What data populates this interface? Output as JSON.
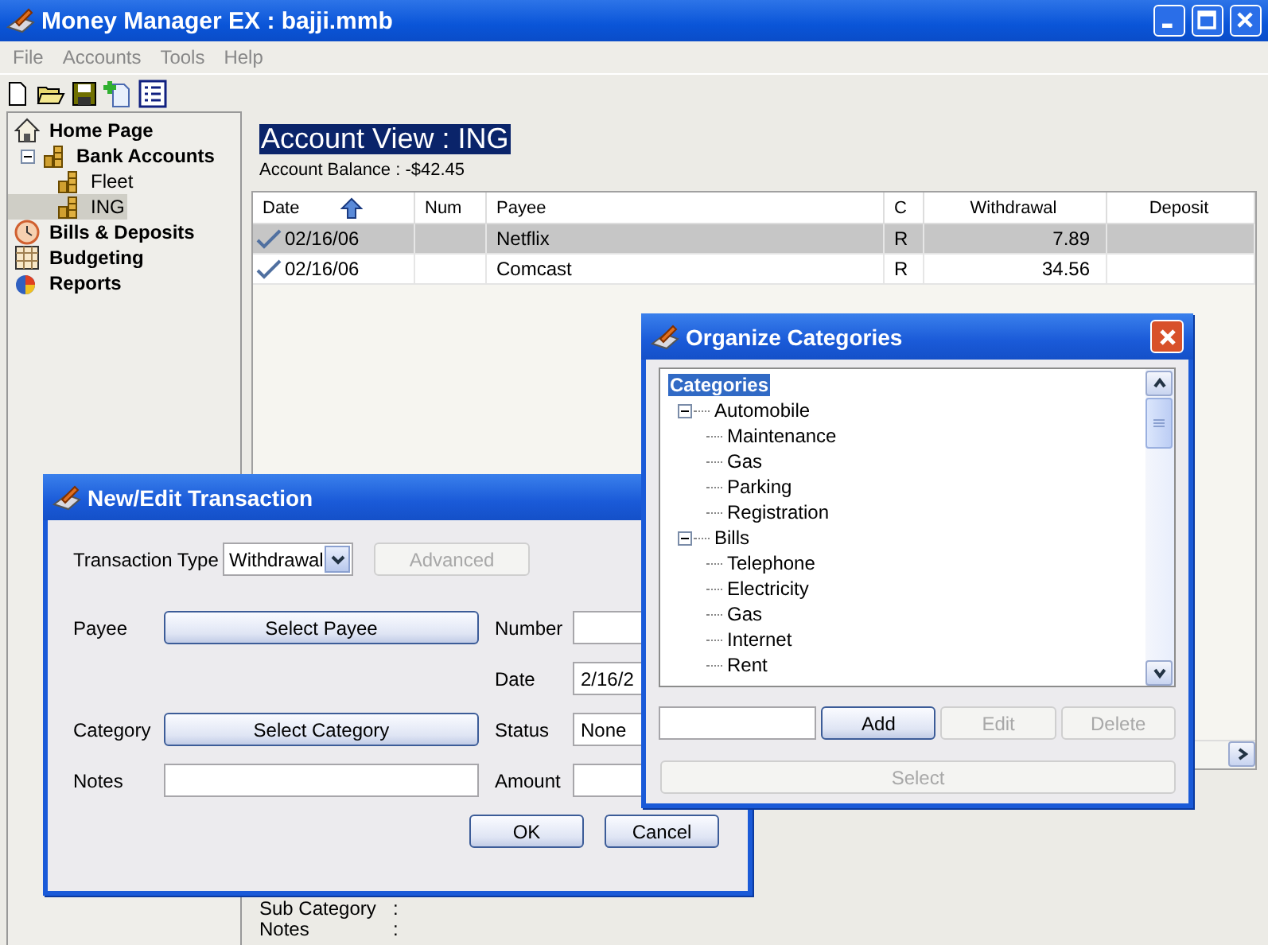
{
  "window": {
    "title": "Money Manager EX : bajji.mmb"
  },
  "menu": [
    "File",
    "Accounts",
    "Tools",
    "Help"
  ],
  "sidebar": {
    "items": [
      {
        "label": "Home Page",
        "kind": "home",
        "selected": false
      },
      {
        "label": "Bank Accounts",
        "kind": "accounts",
        "selected": false,
        "expanded": true,
        "children": [
          {
            "label": "Fleet",
            "kind": "account",
            "selected": false
          },
          {
            "label": "ING",
            "kind": "account",
            "selected": true
          }
        ]
      },
      {
        "label": "Bills & Deposits",
        "kind": "bills",
        "selected": false
      },
      {
        "label": "Budgeting",
        "kind": "budget",
        "selected": false
      },
      {
        "label": "Reports",
        "kind": "reports",
        "selected": false
      }
    ]
  },
  "account_view": {
    "title": "Account View : ING",
    "balance": "Account Balance : -$42.45"
  },
  "table": {
    "columns": [
      {
        "label": "Date",
        "sorted": true
      },
      {
        "label": "Num",
        "sorted": false
      },
      {
        "label": "Payee",
        "sorted": false
      },
      {
        "label": "C",
        "sorted": false
      },
      {
        "label": "Withdrawal",
        "sorted": false
      },
      {
        "label": "Deposit",
        "sorted": false
      }
    ],
    "rows": [
      {
        "selected": true,
        "date": "02/16/06",
        "payee": "Netflix",
        "c": "R",
        "withdrawal": "7.89"
      },
      {
        "selected": false,
        "date": "02/16/06",
        "payee": "Comcast",
        "c": "R",
        "withdrawal": "34.56"
      }
    ]
  },
  "details": [
    {
      "label": "Sub Category",
      "sep": ":"
    },
    {
      "label": "Notes",
      "sep": ":"
    }
  ],
  "transaction_dialog": {
    "title": "New/Edit Transaction",
    "type_label": "Transaction Type",
    "type_value": "Withdrawal",
    "advanced": {
      "label": "Advanced",
      "disabled": true
    },
    "payee_label": "Payee",
    "payee_button": "Select Payee",
    "number_label": "Number",
    "date_label": "Date",
    "date_value": "2/16/2",
    "category_label": "Category",
    "category_button": "Select Category",
    "status_label": "Status",
    "status_value": "None",
    "notes_label": "Notes",
    "amount_label": "Amount",
    "buttons": [
      "OK",
      "Cancel"
    ]
  },
  "categories_dialog": {
    "title": "Organize Categories",
    "tree": {
      "label": "Categories",
      "selected": true,
      "children": [
        {
          "label": "Automobile",
          "expanded": true,
          "selected": false,
          "children": [
            {
              "label": "Maintenance",
              "selected": false
            },
            {
              "label": "Gas",
              "selected": false
            },
            {
              "label": "Parking",
              "selected": false
            },
            {
              "label": "Registration",
              "selected": false
            }
          ]
        },
        {
          "label": "Bills",
          "expanded": true,
          "selected": false,
          "children": [
            {
              "label": "Telephone",
              "selected": false
            },
            {
              "label": "Electricity",
              "selected": false
            },
            {
              "label": "Gas",
              "selected": false
            },
            {
              "label": "Internet",
              "selected": false
            },
            {
              "label": "Rent",
              "selected": false
            }
          ]
        }
      ]
    },
    "buttons": [
      {
        "label": "Add",
        "disabled": false
      },
      {
        "label": "Edit",
        "disabled": true
      },
      {
        "label": "Delete",
        "disabled": true
      }
    ],
    "select": {
      "label": "Select",
      "disabled": true
    }
  }
}
